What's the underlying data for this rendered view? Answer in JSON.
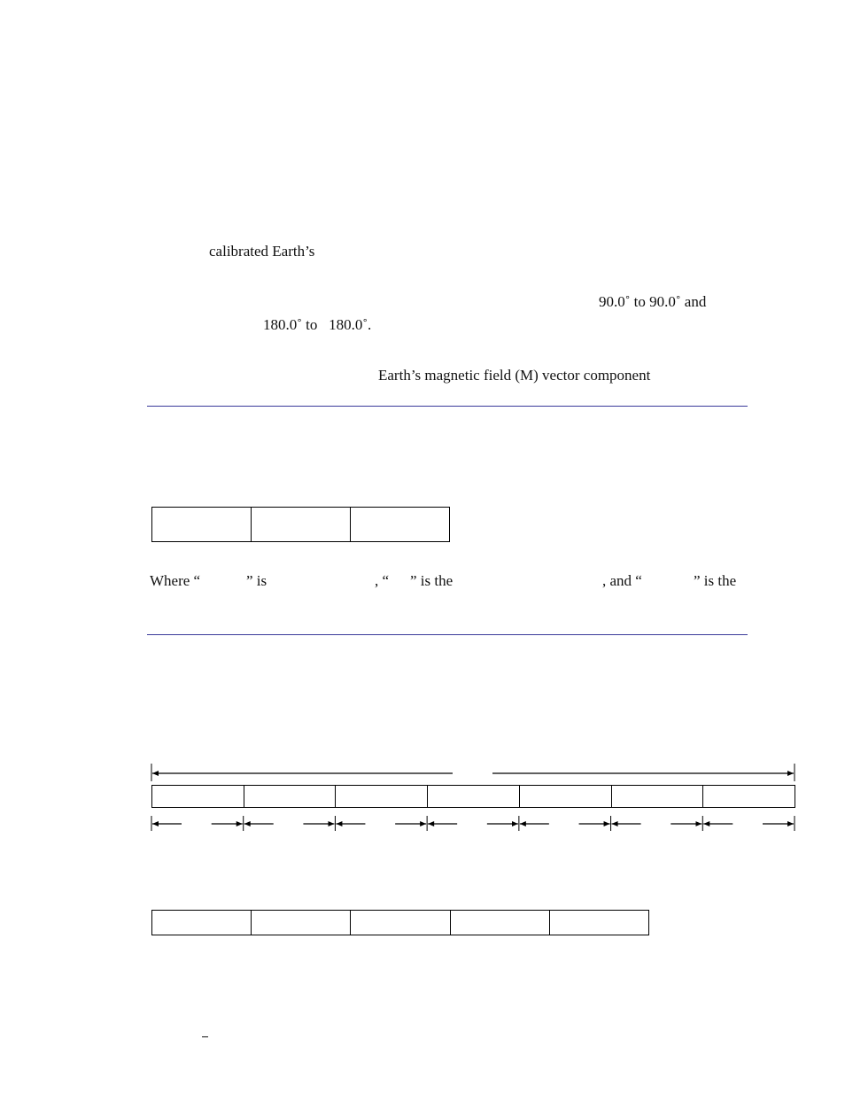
{
  "text_fragments": {
    "calibrated": "calibrated Earth’s",
    "lat_range": "90.0˚ to 90.0˚ and",
    "lon_range": "180.0˚ to   180.0˚.",
    "magnetic_field": "Earth’s magnetic field (M) vector component"
  },
  "where_line": {
    "p1": "Where “",
    "p2": "” is",
    "p3": ", “",
    "p4": "” is the",
    "p5": ", and “",
    "p6": "” is the"
  },
  "tables": {
    "three_field": {
      "cells": [
        "",
        "",
        ""
      ]
    },
    "seven_field": {
      "cells": [
        "",
        "",
        "",
        "",
        "",
        "",
        ""
      ]
    },
    "five_field": {
      "cells": [
        "",
        "",
        "",
        "",
        ""
      ]
    }
  },
  "colors": {
    "rule": "#3a3a9a",
    "border": "#000000"
  }
}
